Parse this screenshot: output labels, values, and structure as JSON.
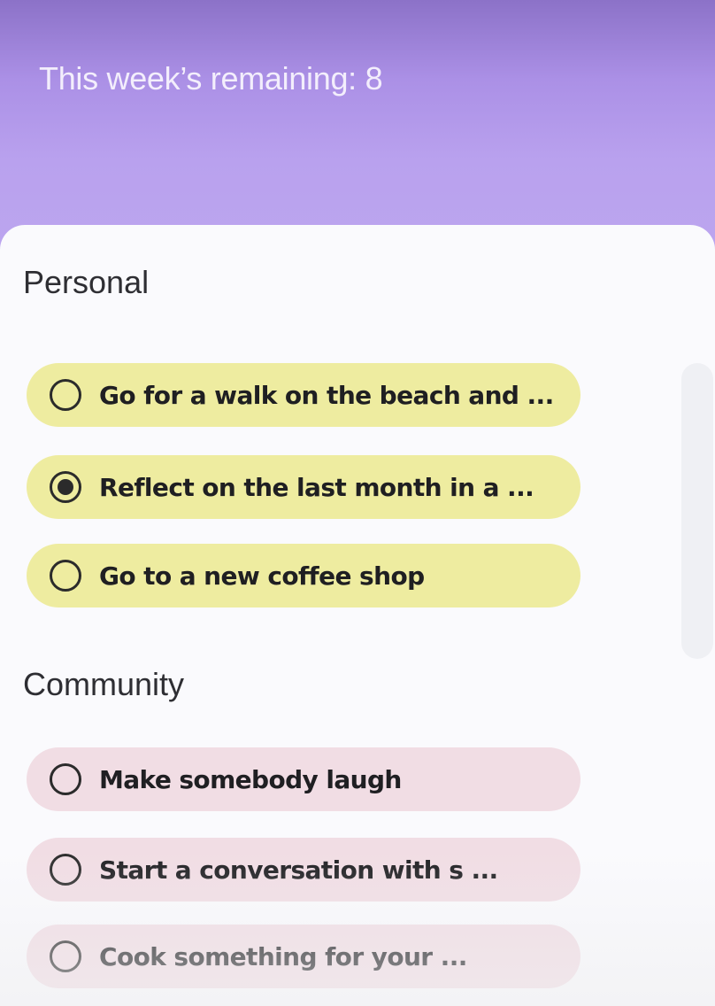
{
  "header": {
    "remaining_text": "This week’s remaining: 8"
  },
  "sections": [
    {
      "title": "Personal",
      "items": [
        {
          "label": "Go for a walk on the beach and ...",
          "selected": false
        },
        {
          "label": "Reflect on the last month in a ...",
          "selected": true
        },
        {
          "label": "Go to a new coffee shop",
          "selected": false
        }
      ]
    },
    {
      "title": "Community",
      "items": [
        {
          "label": "Make somebody laugh",
          "selected": false
        },
        {
          "label": "Start a conversation with s ...",
          "selected": false
        },
        {
          "label": "Cook something for your ...",
          "selected": false
        }
      ]
    }
  ],
  "colors": {
    "header_purple": "#b9a1ec",
    "personal_pill": "#eeeca0",
    "community_pill": "#f1dde4",
    "sheet_bg": "#fafafd"
  },
  "icons": {
    "unselected": "radio-unchecked-icon",
    "selected": "radio-checked-icon"
  }
}
